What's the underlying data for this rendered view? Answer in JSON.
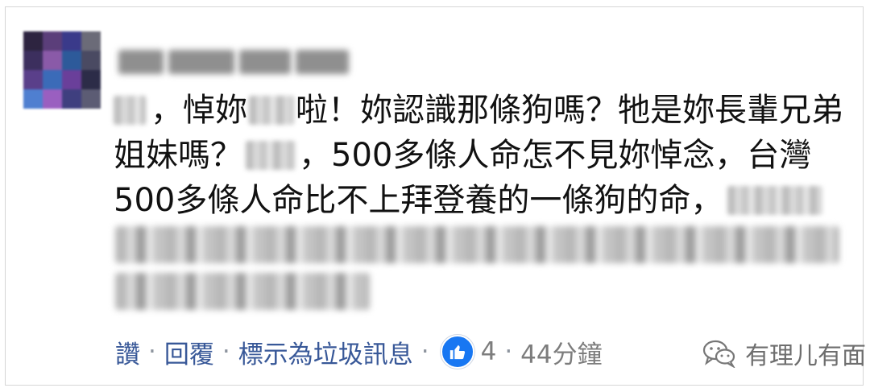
{
  "comment": {
    "lines": [
      [
        "，悼妳",
        "啦！妳認識那條狗嗎？牠是妳長輩兄弟"
      ],
      [
        "姐妹嗎？",
        "，500多條人命怎不見妳悼念，台灣"
      ],
      [
        "500多條人命比不上拜登養的一條狗的命，"
      ]
    ]
  },
  "actions": {
    "like_label": "讚",
    "reply_label": "回覆",
    "spam_label": "標示為垃圾訊息",
    "separator": "·",
    "reaction_count": "4",
    "timestamp": "44分鐘",
    "reaction_icon": "thumbs-up-icon"
  },
  "watermark": {
    "text": "有理儿有面",
    "icon": "wechat-icon"
  },
  "colors": {
    "link": "#385898",
    "reaction": "#1877f2",
    "meta": "#7d7d7d"
  }
}
